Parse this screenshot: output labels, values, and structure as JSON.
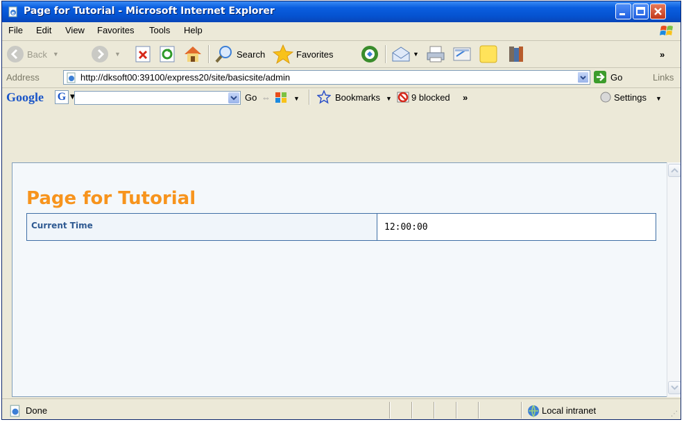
{
  "window": {
    "title": "Page for Tutorial - Microsoft Internet Explorer",
    "minimize_icon": "minimize-icon",
    "maximize_icon": "maximize-icon",
    "close_icon": "close-icon"
  },
  "menu": {
    "items": [
      "File",
      "Edit",
      "View",
      "Favorites",
      "Tools",
      "Help"
    ]
  },
  "toolbar": {
    "back_label": "Back",
    "search_label": "Search",
    "favorites_label": "Favorites"
  },
  "address": {
    "label": "Address",
    "url": "http://dksoft00:39100/express20/site/basicsite/admin",
    "go_label": "Go",
    "links_label": "Links"
  },
  "google_bar": {
    "logo": "Google",
    "go_label": "Go",
    "bookmarks_label": "Bookmarks",
    "blocked_label": "9 blocked",
    "settings_label": "Settings"
  },
  "page": {
    "heading": "Page for Tutorial",
    "table": {
      "label": "Current Time",
      "value": "12:00:00"
    }
  },
  "status": {
    "text": "Done",
    "zone": "Local intranet"
  },
  "colors": {
    "heading": "#f7941d",
    "table_border": "#3e6ea5",
    "label_text": "#2f5a92",
    "content_bg": "#f4f8fb"
  }
}
